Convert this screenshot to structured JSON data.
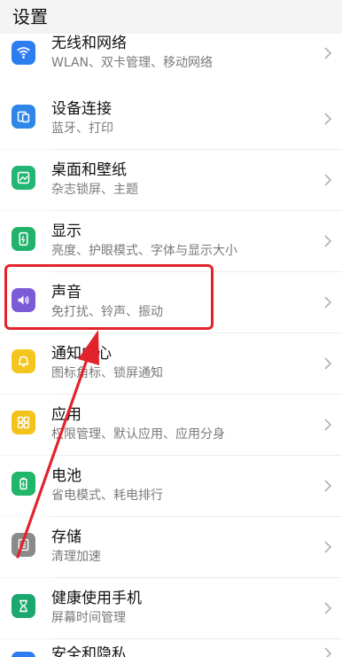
{
  "header": {
    "title": "设置"
  },
  "items": [
    {
      "label": "无线和网络",
      "sub": "WLAN、双卡管理、移动网络",
      "icon": "wifi-icon",
      "color": "#2b7df0"
    },
    {
      "label": "设备连接",
      "sub": "蓝牙、打印",
      "icon": "device-connect-icon",
      "color": "#2e86e8"
    },
    {
      "label": "桌面和壁纸",
      "sub": "杂志锁屏、主题",
      "icon": "wallpaper-icon",
      "color": "#22b573"
    },
    {
      "label": "显示",
      "sub": "亮度、护眼模式、字体与显示大小",
      "icon": "display-icon",
      "color": "#21b36b"
    },
    {
      "label": "声音",
      "sub": "免打扰、铃声、振动",
      "icon": "sound-icon",
      "color": "#7b5bd6"
    },
    {
      "label": "通知中心",
      "sub": "图标角标、锁屏通知",
      "icon": "bell-icon",
      "color": "#f4c51c"
    },
    {
      "label": "应用",
      "sub": "权限管理、默认应用、应用分身",
      "icon": "apps-icon",
      "color": "#f2c31a"
    },
    {
      "label": "电池",
      "sub": "省电模式、耗电排行",
      "icon": "battery-icon",
      "color": "#1fb56a"
    },
    {
      "label": "存储",
      "sub": "清理加速",
      "icon": "storage-icon",
      "color": "#8a8a8a"
    },
    {
      "label": "健康使用手机",
      "sub": "屏幕时间管理",
      "icon": "hourglass-icon",
      "color": "#1aa870"
    },
    {
      "label": "安全和隐私",
      "sub": "",
      "icon": "shield-icon",
      "color": "#2b7df0"
    }
  ],
  "colors": {
    "highlight": "#e3232c",
    "arrow": "#e3232c"
  }
}
